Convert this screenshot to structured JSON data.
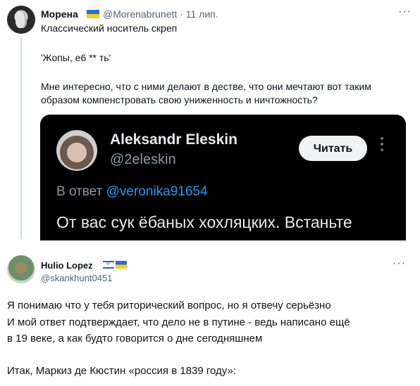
{
  "tweet1": {
    "name": "Морена",
    "handle": "@Morenabrunett",
    "date": "11 лип.",
    "more": "···",
    "lines": [
      "Классический носитель скреп",
      "'Жопы, е6 ** ть'",
      "Мне интересно, что с ними делают в дестве, что они мечтают вот таким",
      "образом компенстровать свою униженность и ничтожность?"
    ]
  },
  "embed": {
    "name": "Aleksandr Eleskin",
    "handle": "@2eleskin",
    "follow": "Читать",
    "reply_prefix": "В ответ",
    "reply_mention": "@veronika91654",
    "text": "От вас сук ёбаных хохляцких. Встаньте"
  },
  "tweet2": {
    "name": "Hulio Lopez",
    "handle": "@skankhunt0451",
    "more": "···",
    "lines": [
      "Я понимаю что у тебя риторический вопрос, но я отвечу серьёзно",
      "И мой ответ подтверждает, что дело не в путине - ведь написано ещё",
      "в 19 веке, а как будто говорится о дне сегодняшнем",
      "Итак, Маркиз де Кюстин «россия в 1839 году»:"
    ]
  },
  "colors": {
    "link": "#1d9bf0",
    "secondary": "#536471",
    "embed_bg": "#000000"
  },
  "icons": [
    "ukraine-flag-icon",
    "israel-flag-icon",
    "more-icon"
  ]
}
